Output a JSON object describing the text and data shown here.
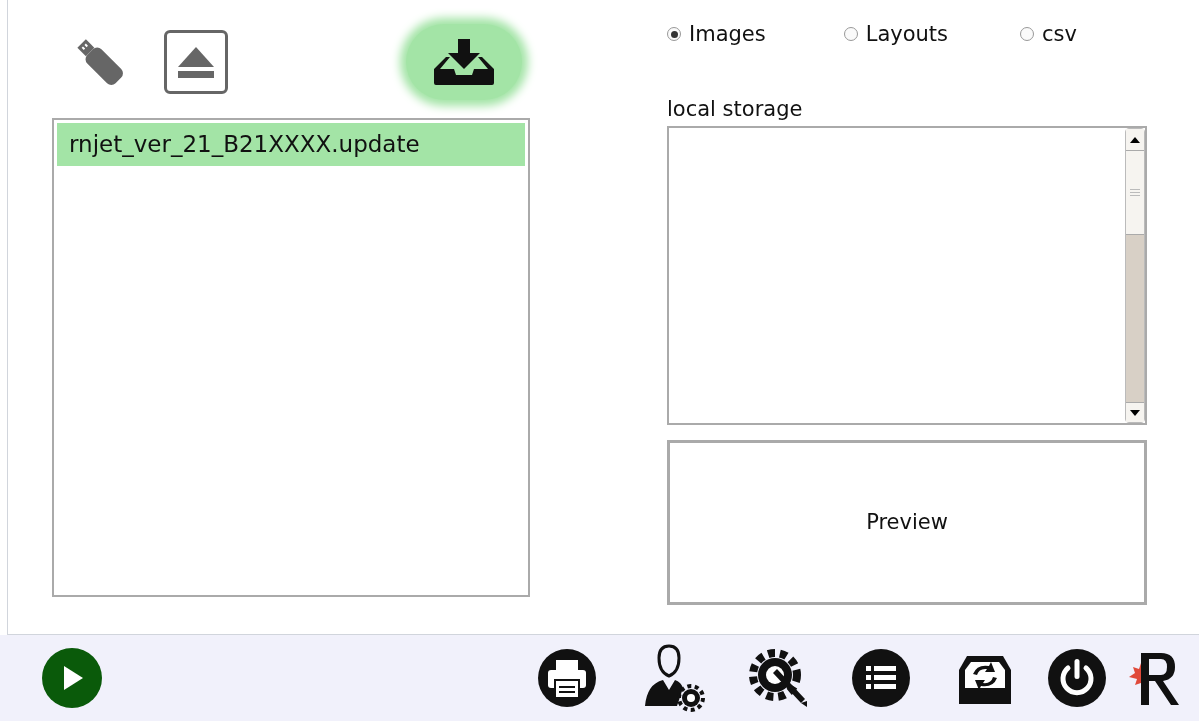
{
  "file_list": {
    "items": [
      {
        "label": "rnjet_ver_21_B21XXXX.update",
        "selected": true
      }
    ]
  },
  "file_types": [
    {
      "label": "Images",
      "selected": true
    },
    {
      "label": "Layouts",
      "selected": false
    },
    {
      "label": "csv",
      "selected": false
    }
  ],
  "local_storage": {
    "label": "local storage"
  },
  "preview": {
    "label": "Preview"
  }
}
